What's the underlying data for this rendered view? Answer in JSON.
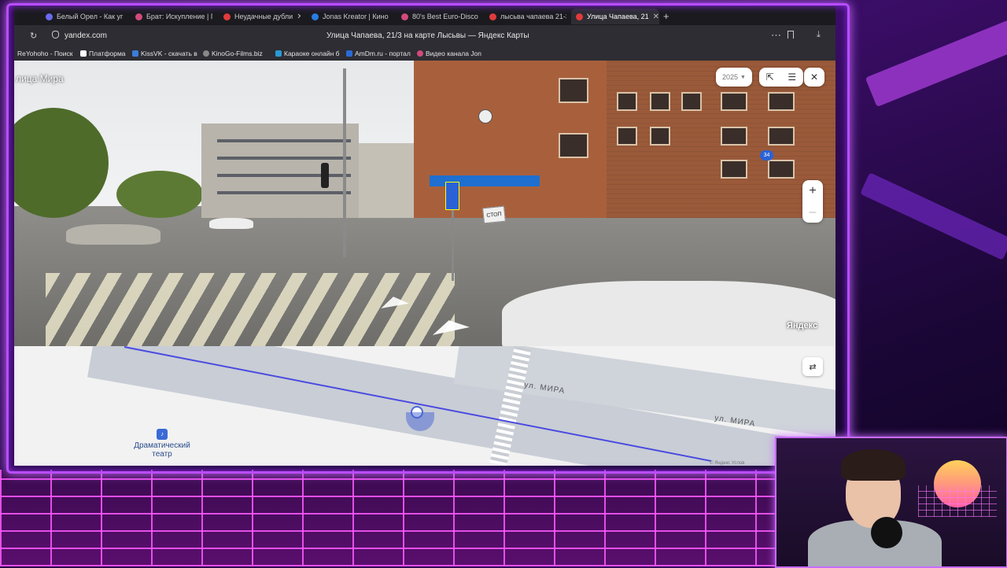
{
  "browser": {
    "tabs": [
      {
        "label": "Белый Орел - Как уп",
        "color": "#6a6af0",
        "active": false
      },
      {
        "label": "Брат: Искупление | Г",
        "color": "#d24a7a",
        "active": false
      },
      {
        "label": "Неудачные дубли",
        "color": "#e03b3b",
        "active": false,
        "closable": true
      },
      {
        "label": "Jonas Kreator | Кино",
        "color": "#2a7ce0",
        "active": false
      },
      {
        "label": "80's Best Euro-Disco",
        "color": "#d24a7a",
        "active": false
      },
      {
        "label": "лысьва чапаева 21-3",
        "color": "#e03b3b",
        "active": false
      },
      {
        "label": "Улица Чапаева, 21",
        "color": "#e03b3b",
        "active": true,
        "closable": true
      }
    ],
    "new_tab_label": "+",
    "address": "yandex.com",
    "page_title": "Улица Чапаева, 21/3 на карте Лысьвы — Яндекс Карты",
    "bookmarks": [
      {
        "label": "ReYohoho - Поиск",
        "color": "#cfcfcf"
      },
      {
        "label": "Платформа",
        "color": "#ffffff"
      },
      {
        "label": "KissVK - скачать в",
        "color": "#3b7dd8"
      },
      {
        "label": "KinoGo-Films.biz",
        "color": "#888888"
      },
      {
        "label": "Караоке онлайн б",
        "color": "#2a9ad6"
      },
      {
        "label": "AmDm.ru - портал",
        "color": "#2a6ad6"
      },
      {
        "label": "Видео канала Jon",
        "color": "#d24a7a"
      }
    ]
  },
  "panorama": {
    "street_label": "лица Мира",
    "year_selector": "2025",
    "stop_sign": "СТОП",
    "badge": "34",
    "watermark": "Яндекс",
    "zoom_in": "+",
    "zoom_out": "–"
  },
  "map": {
    "street_label_1": "ул. МИРА",
    "street_label_2": "ул. МИРА",
    "poi_label": "Драматический театр",
    "copyright": "© Яндекс  Услов"
  },
  "icons": {
    "back": "reload-icon",
    "close": "close-icon",
    "share": "share-icon",
    "menu": "menu-icon",
    "expand": "expand-arrows-icon"
  }
}
